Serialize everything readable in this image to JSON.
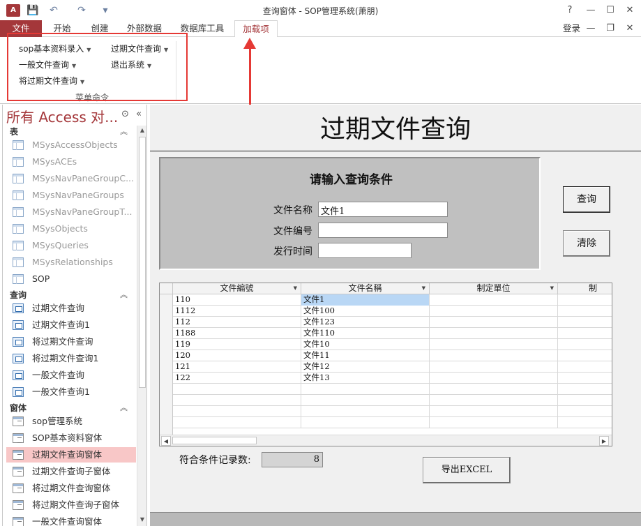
{
  "window": {
    "title": "查询窗体 - SOP管理系统(萧朋)",
    "logo_text": "A"
  },
  "title_controls": {
    "help": "?",
    "minimize": "—",
    "maximize": "☐",
    "close": "✕"
  },
  "quick_access": {
    "save": "💾",
    "undo": "↶",
    "redo": "↷",
    "customize": "▾"
  },
  "ribbon_tabs": [
    {
      "label": "文件"
    },
    {
      "label": "开始"
    },
    {
      "label": "创建"
    },
    {
      "label": "外部数据"
    },
    {
      "label": "数据库工具"
    },
    {
      "label": "加载项"
    }
  ],
  "login_label": "登录",
  "doc_controls": {
    "minimize": "—",
    "restore": "❐",
    "close": "✕"
  },
  "ribbon": {
    "menu_items": [
      {
        "label": "sop基本资料录入"
      },
      {
        "label": "一般文件查询"
      },
      {
        "label": "将过期文件查询"
      },
      {
        "label": "过期文件查询"
      },
      {
        "label": "退出系统"
      }
    ],
    "group_label": "菜单命令"
  },
  "nav": {
    "header": "所有 Access 对...",
    "sections": [
      {
        "label": "表",
        "items": [
          {
            "label": "MSysAccessObjects"
          },
          {
            "label": "MSysACEs"
          },
          {
            "label": "MSysNavPaneGroupC..."
          },
          {
            "label": "MSysNavPaneGroups"
          },
          {
            "label": "MSysNavPaneGroupT..."
          },
          {
            "label": "MSysObjects"
          },
          {
            "label": "MSysQueries"
          },
          {
            "label": "MSysRelationships"
          },
          {
            "label": "SOP"
          }
        ]
      },
      {
        "label": "查询",
        "items": [
          {
            "label": "过期文件查询"
          },
          {
            "label": "过期文件查询1"
          },
          {
            "label": "将过期文件查询"
          },
          {
            "label": "将过期文件查询1"
          },
          {
            "label": "一般文件查询"
          },
          {
            "label": "一般文件查询1"
          }
        ]
      },
      {
        "label": "窗体",
        "items": [
          {
            "label": "sop管理系统"
          },
          {
            "label": "SOP基本资料窗体"
          },
          {
            "label": "过期文件查询窗体"
          },
          {
            "label": "过期文件查询子窗体"
          },
          {
            "label": "将过期文件查询窗体"
          },
          {
            "label": "将过期文件查询子窗体"
          },
          {
            "label": "一般文件查询窗体"
          }
        ]
      }
    ]
  },
  "form": {
    "title": "过期文件查询",
    "criteria_title": "请输入查询条件",
    "fields": [
      {
        "label": "文件名称",
        "value": "文件1"
      },
      {
        "label": "文件编号",
        "value": ""
      },
      {
        "label": "发行时间",
        "value": ""
      }
    ],
    "query_button": "查询",
    "clear_button": "清除",
    "grid": {
      "columns": [
        "文件編號",
        "文件名稱",
        "制定單位",
        "制"
      ],
      "rows": [
        [
          "110",
          "文件1",
          ""
        ],
        [
          "1112",
          "文件100",
          ""
        ],
        [
          "112",
          "文件123",
          ""
        ],
        [
          "1188",
          "文件110",
          ""
        ],
        [
          "119",
          "文件10",
          ""
        ],
        [
          "120",
          "文件11",
          ""
        ],
        [
          "121",
          "文件12",
          ""
        ],
        [
          "122",
          "文件13",
          ""
        ]
      ]
    },
    "count_label": "符合条件记录数:",
    "count_value": "8",
    "export_button": "导出EXCEL"
  }
}
